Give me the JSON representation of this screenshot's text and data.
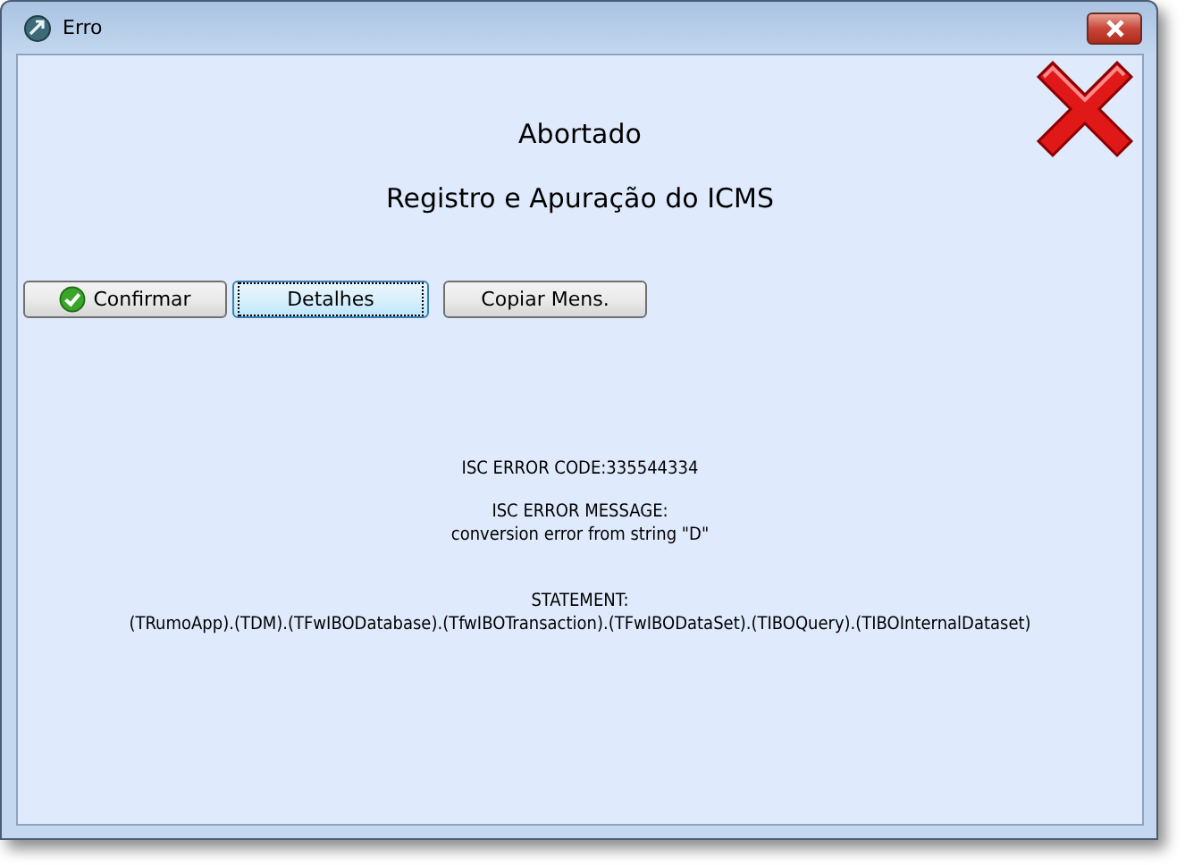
{
  "window": {
    "title": "Erro"
  },
  "heading": "Abortado",
  "subheading": "Registro e Apuração do ICMS",
  "buttons": [
    {
      "label": "Confirmar",
      "focused": false,
      "kind": "confirm"
    },
    {
      "label": "Detalhes",
      "focused": true,
      "kind": "plain"
    },
    {
      "label": "Copiar Mens.",
      "focused": false,
      "kind": "plain"
    }
  ],
  "details": [
    {
      "lines": [
        "ISC ERROR CODE:335544334"
      ]
    },
    {
      "lines": [
        "ISC ERROR MESSAGE:",
        "conversion error from string \"D\""
      ]
    },
    {
      "lines": [
        "STATEMENT:",
        "(TRumoApp).(TDM).(TFwIBODatabase).(TfwIBOTransaction).(TFwIBODataSet).(TIBOQuery).(TIBOInternalDataset)"
      ]
    }
  ]
}
